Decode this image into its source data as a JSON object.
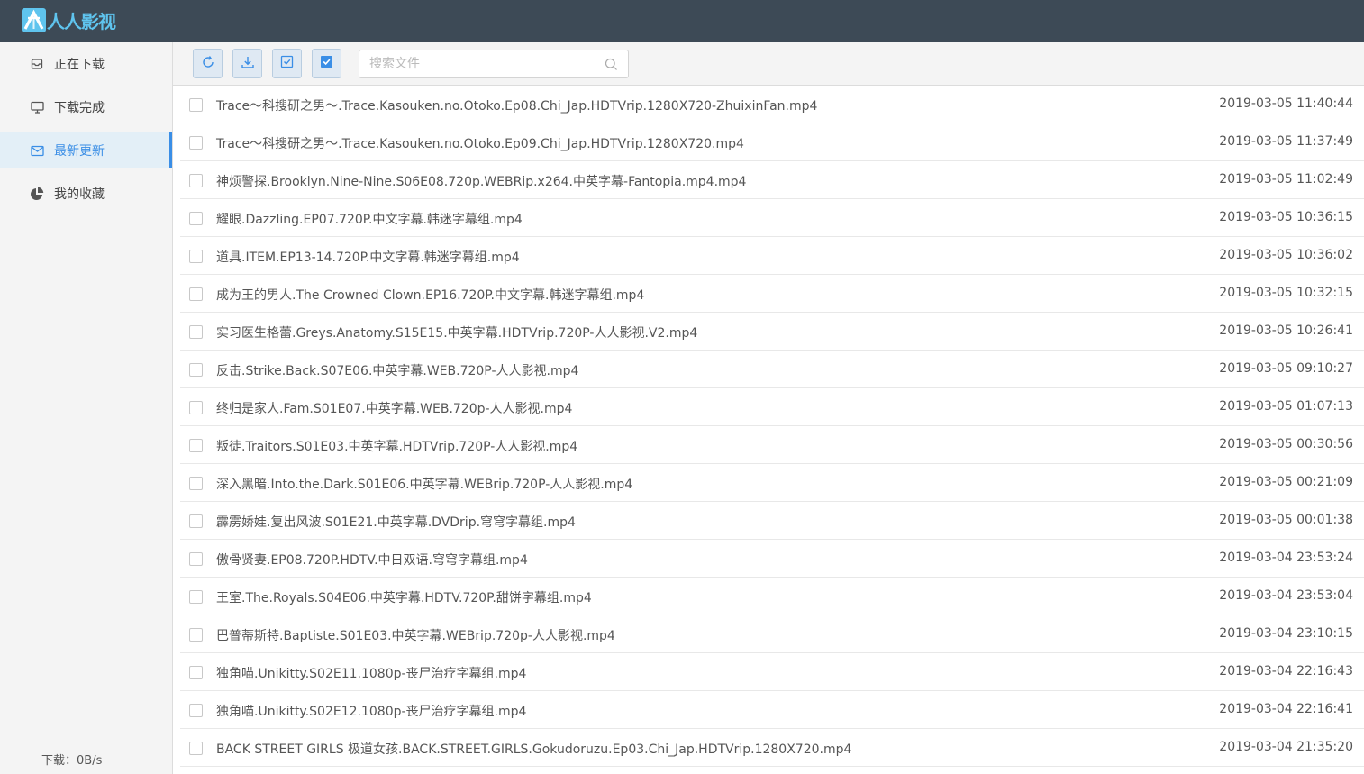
{
  "app": {
    "title": "人人影视"
  },
  "sidebar": {
    "items": [
      {
        "label": "正在下载",
        "icon": "inbox-icon"
      },
      {
        "label": "下载完成",
        "icon": "monitor-icon"
      },
      {
        "label": "最新更新",
        "icon": "mail-icon",
        "active": true
      },
      {
        "label": "我的收藏",
        "icon": "pie-chart-icon"
      }
    ],
    "download_speed": "下载：0B/s"
  },
  "toolbar": {
    "buttons": [
      "refresh-icon",
      "download-icon",
      "check-square-icon",
      "select-all-icon"
    ],
    "search_placeholder": "搜索文件",
    "search_value": ""
  },
  "files": [
    {
      "name": "Trace～科搜研之男～.Trace.Kasouken.no.Otoko.Ep08.Chi_Jap.HDTVrip.1280X720-ZhuixinFan.mp4",
      "date": "2019-03-05 11:40:44"
    },
    {
      "name": "Trace～科搜研之男～.Trace.Kasouken.no.Otoko.Ep09.Chi_Jap.HDTVrip.1280X720.mp4",
      "date": "2019-03-05 11:37:49"
    },
    {
      "name": "神烦警探.Brooklyn.Nine-Nine.S06E08.720p.WEBRip.x264.中英字幕-Fantopia.mp4.mp4",
      "date": "2019-03-05 11:02:49"
    },
    {
      "name": "耀眼.Dazzling.EP07.720P.中文字幕.韩迷字幕组.mp4",
      "date": "2019-03-05 10:36:15"
    },
    {
      "name": "道具.ITEM.EP13-14.720P.中文字幕.韩迷字幕组.mp4",
      "date": "2019-03-05 10:36:02"
    },
    {
      "name": "成为王的男人.The Crowned Clown.EP16.720P.中文字幕.韩迷字幕组.mp4",
      "date": "2019-03-05 10:32:15"
    },
    {
      "name": "实习医生格蕾.Greys.Anatomy.S15E15.中英字幕.HDTVrip.720P-人人影视.V2.mp4",
      "date": "2019-03-05 10:26:41"
    },
    {
      "name": "反击.Strike.Back.S07E06.中英字幕.WEB.720P-人人影视.mp4",
      "date": "2019-03-05 09:10:27"
    },
    {
      "name": "终归是家人.Fam.S01E07.中英字幕.WEB.720p-人人影视.mp4",
      "date": "2019-03-05 01:07:13"
    },
    {
      "name": "叛徒.Traitors.S01E03.中英字幕.HDTVrip.720P-人人影视.mp4",
      "date": "2019-03-05 00:30:56"
    },
    {
      "name": "深入黑暗.Into.the.Dark.S01E06.中英字幕.WEBrip.720P-人人影视.mp4",
      "date": "2019-03-05 00:21:09"
    },
    {
      "name": "霹雳娇娃.复出风波.S01E21.中英字幕.DVDrip.穹穹字幕组.mp4",
      "date": "2019-03-05 00:01:38"
    },
    {
      "name": "傲骨贤妻.EP08.720P.HDTV.中日双语.穹穹字幕组.mp4",
      "date": "2019-03-04 23:53:24"
    },
    {
      "name": "王室.The.Royals.S04E06.中英字幕.HDTV.720P.甜饼字幕组.mp4",
      "date": "2019-03-04 23:53:04"
    },
    {
      "name": "巴普蒂斯特.Baptiste.S01E03.中英字幕.WEBrip.720p-人人影视.mp4",
      "date": "2019-03-04 23:10:15"
    },
    {
      "name": "独角喵.Unikitty.S02E11.1080p-丧尸治疗字幕组.mp4",
      "date": "2019-03-04 22:16:43"
    },
    {
      "name": "独角喵.Unikitty.S02E12.1080p-丧尸治疗字幕组.mp4",
      "date": "2019-03-04 22:16:41"
    },
    {
      "name": "BACK STREET GIRLS 极道女孩.BACK.STREET.GIRLS.Gokudoruzu.Ep03.Chi_Jap.HDTVrip.1280X720.mp4",
      "date": "2019-03-04 21:35:20"
    }
  ]
}
